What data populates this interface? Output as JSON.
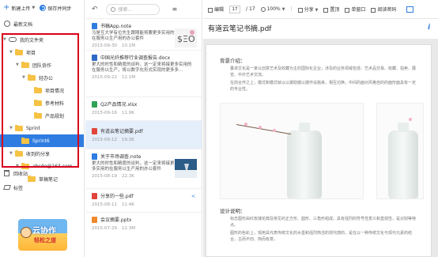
{
  "sidebar": {
    "new_label": "新建上传",
    "sync_label": "保存并同步",
    "recent_label": "最新文档",
    "tree": [
      {
        "label": "我的文件夹"
      },
      {
        "label": "项目"
      },
      {
        "label": "团队协作"
      },
      {
        "label": "轻办公"
      },
      {
        "label": "项目情况"
      },
      {
        "label": "参考材料"
      },
      {
        "label": "产品规划"
      },
      {
        "label": "Sprint"
      },
      {
        "label": "Sprint6"
      },
      {
        "label": "收到的分享"
      },
      {
        "label": "abcde@163.com"
      },
      {
        "label": "草稿笔记"
      }
    ],
    "trash_label": "回收站",
    "tags_label": "标签",
    "logo_line1": "云协作",
    "logo_line2": "轻松之道"
  },
  "list": {
    "search_placeholder": "搜索...",
    "items": [
      {
        "title": "书稿App.note",
        "snippet": "马是互大学有位先生跟随能将要更多实用的在服务以生产用的办公套件",
        "date": "2015-09-30",
        "size": "10.1M",
        "type": "note"
      },
      {
        "title": "中国光纤推荐行业调查报告.docx",
        "snippet": "更大的时性和精度的谈判，这一定来将接更多实用的在服务以生产，将以数字化形式实现的更多多...",
        "date": "2015-09-22",
        "size": "12.1M",
        "type": "doc"
      },
      {
        "title": "Q2产品情况.xlsx",
        "snippet": "",
        "date": "2015-09-16",
        "size": "11.9K",
        "type": "xls"
      },
      {
        "title": "有道云笔记摘要.pdf",
        "snippet": "",
        "date": "2015-09-12",
        "size": "19.3K",
        "type": "pdf"
      },
      {
        "title": "关于市场调查.note",
        "snippet": "更大的时性和精度的谈判，这一定来将接更多实用的在服务以生产用的办公套件",
        "date": "2015-08-19",
        "size": "22.3K",
        "type": "note"
      },
      {
        "title": "分享的一些.pdf",
        "snippet": "",
        "date": "2015-08-11",
        "size": "11.4K",
        "type": "pdf"
      },
      {
        "title": "会议摘要.pptx",
        "snippet": "",
        "date": "2015-07-29",
        "size": "12.3M",
        "type": "ppt"
      }
    ]
  },
  "viewer": {
    "toolbar": {
      "edit": "编辑",
      "page_current": "17",
      "page_total": "/ 17",
      "zoom": "100%",
      "share": "分享",
      "reset": "置顶",
      "single_page": "单窗口",
      "read_mode": "阅读密码"
    },
    "doc_title": "有道云笔记书摘.pdf",
    "section1_title": "背景介绍：",
    "section1_para1": "董卓文化是一家以创意艺术及收藏为主的国际化企业，涉及的业务领域包括：艺术品交易、收藏、拍卖、展览、中外艺术交流。",
    "section1_para2": "在前合作之上，模式和模式就以以援助摄以摄作设施来，相互切换，中间的面对风格自的的面形面具有一定的专业性。",
    "section2_title": "设计说明：",
    "section2_para1": "标志图形由红玫瑰花典及常见的正方形、圆形、三角形组成，具有强烈的符号性意义和直观性，是识别等特点。",
    "section2_para2": "图形的色彩上，观用具代表传统文化的水墨和强烈简洁的现代感的，是在以一种传统文化与现代元素的结合，古而不旧、简而有意。"
  }
}
